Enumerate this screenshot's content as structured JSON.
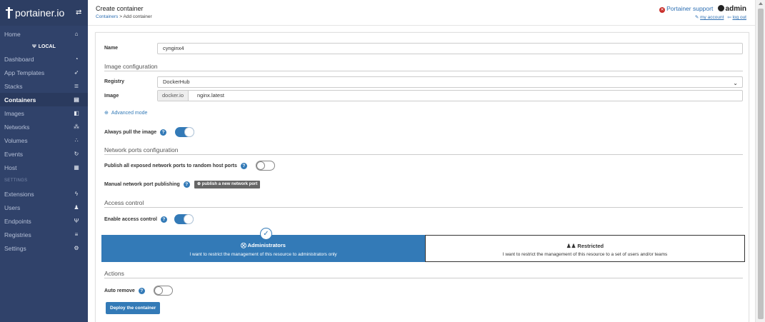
{
  "sidebar": {
    "brand": "portainer.io",
    "toggle_icon": "⇄",
    "home": {
      "label": "Home",
      "icon": "home-icon",
      "glyph": "⌂"
    },
    "endpoint": "LOCAL",
    "endpoint_glyph": "Ψ",
    "items": [
      {
        "label": "Dashboard",
        "glyph": "◔"
      },
      {
        "label": "App Templates",
        "glyph": "➶"
      },
      {
        "label": "Stacks",
        "glyph": "≣"
      },
      {
        "label": "Containers",
        "glyph": "▤"
      },
      {
        "label": "Images",
        "glyph": "◧"
      },
      {
        "label": "Networks",
        "glyph": "⁂"
      },
      {
        "label": "Volumes",
        "glyph": "∴"
      },
      {
        "label": "Events",
        "glyph": "↻"
      },
      {
        "label": "Host",
        "glyph": "▦"
      }
    ],
    "settings_section": "SETTINGS",
    "settings_items": [
      {
        "label": "Extensions",
        "glyph": "ϟ"
      },
      {
        "label": "Users",
        "glyph": "♟"
      },
      {
        "label": "Endpoints",
        "glyph": "Ψ"
      },
      {
        "label": "Registries",
        "glyph": "≡"
      },
      {
        "label": "Settings",
        "glyph": "⚙"
      }
    ]
  },
  "header": {
    "title": "Create container",
    "breadcrumb_link": "Containers",
    "breadcrumb_sep": " > ",
    "breadcrumb_current": "Add container",
    "support": "Portainer support",
    "user": "admin",
    "my_account": "my account",
    "log_out": "log out"
  },
  "form": {
    "name_label": "Name",
    "name_value": "cynginx4",
    "image_config_title": "Image configuration",
    "registry_label": "Registry",
    "registry_value": "DockerHub",
    "image_label": "Image",
    "image_prefix": "docker.io",
    "image_value": "nginx.latest",
    "advanced_mode": "Advanced mode",
    "always_pull_label": "Always pull the image",
    "network_ports_title": "Network ports configuration",
    "publish_all_label": "Publish all exposed network ports to random host ports",
    "manual_publish_label": "Manual network port publishing",
    "publish_new_btn": "publish a new network port",
    "access_control_title": "Access control",
    "enable_access_label": "Enable access control",
    "admins_title": "Administrators",
    "admins_desc": "I want to restrict the management of this resource to administrators only",
    "restricted_title": "Restricted",
    "restricted_desc": "I want to restrict the management of this resource to a set of users and/or teams",
    "actions_title": "Actions",
    "auto_remove_label": "Auto remove",
    "deploy_btn": "Deploy the container"
  },
  "toggles": {
    "always_pull": true,
    "publish_all": false,
    "enable_access": true,
    "auto_remove": false
  },
  "colors": {
    "sidebar_bg": "#30426a",
    "accent": "#337ab7",
    "danger": "#c9302c"
  }
}
